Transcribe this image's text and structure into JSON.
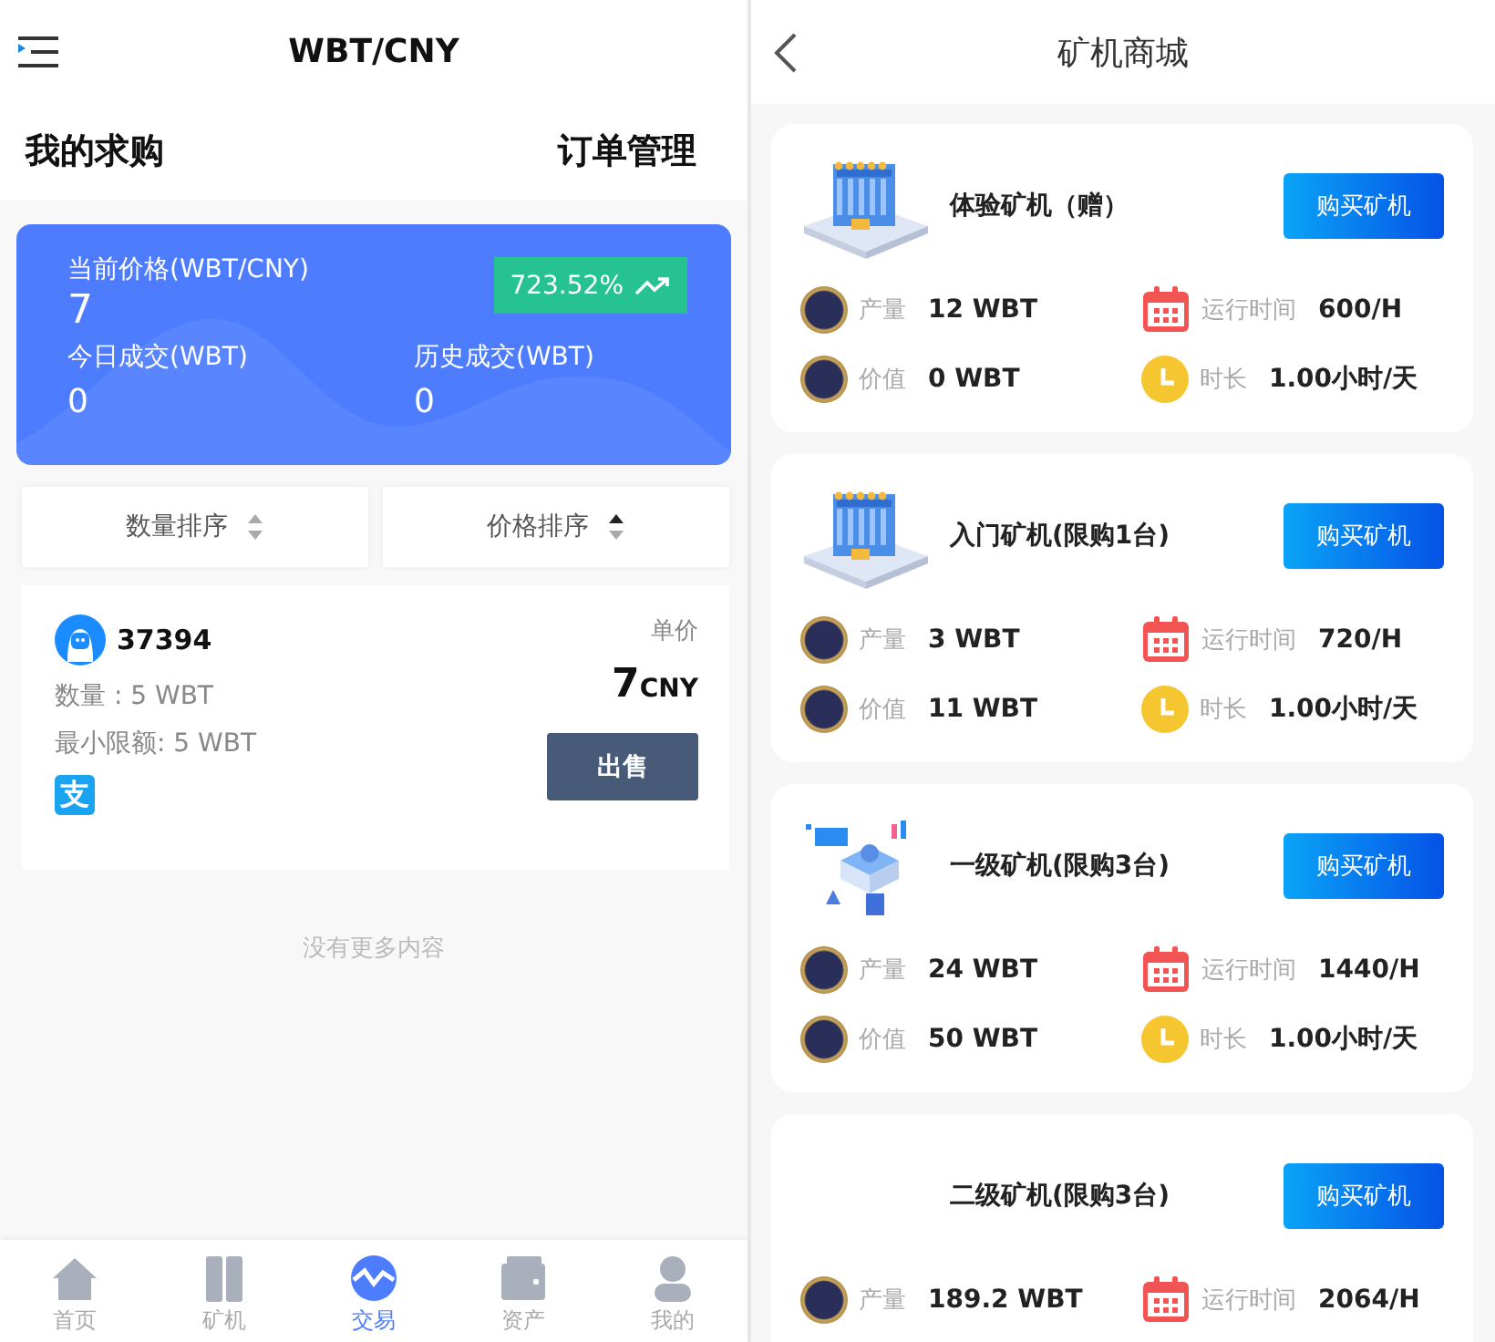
{
  "trade": {
    "title": "WBT/CNY",
    "left_link": "我的求购",
    "right_link": "订单管理",
    "summary": {
      "price_label": "当前价格(WBT/CNY)",
      "price": "7",
      "change": "723.52%",
      "today_label": "今日成交(WBT)",
      "today": "0",
      "history_label": "历史成交(WBT)",
      "history": "0"
    },
    "sorts": [
      {
        "label": "数量排序",
        "selected": false
      },
      {
        "label": "价格排序",
        "selected": true
      }
    ],
    "orders": [
      {
        "user": "37394",
        "price_label": "单价",
        "price": "7",
        "currency": "CNY",
        "quantity": "数量 : 5 WBT",
        "min_limit": "最小限额: 5 WBT",
        "payment_icon": "支",
        "action": "出售"
      }
    ],
    "end_note": "没有更多内容",
    "nav": [
      {
        "label": "首页",
        "selected": false
      },
      {
        "label": "矿机",
        "selected": false
      },
      {
        "label": "交易",
        "selected": true
      },
      {
        "label": "资产",
        "selected": false
      },
      {
        "label": "我的",
        "selected": false
      }
    ]
  },
  "shop": {
    "title": "矿机商城",
    "miners": [
      {
        "name": "体验矿机（赠）",
        "kind": "rack",
        "button": "购买矿机",
        "stats": [
          {
            "kind": "coin",
            "label": "产量",
            "value": "12 WBT"
          },
          {
            "kind": "calendar",
            "label": "运行时间",
            "value": "600/H"
          },
          {
            "kind": "coin",
            "label": "价值",
            "value": "0 WBT"
          },
          {
            "kind": "clock",
            "label": "时长",
            "value": "1.00小时/天"
          }
        ]
      },
      {
        "name": "入门矿机(限购1台)",
        "kind": "rack",
        "button": "购买矿机",
        "stats": [
          {
            "kind": "coin",
            "label": "产量",
            "value": "3 WBT"
          },
          {
            "kind": "calendar",
            "label": "运行时间",
            "value": "720/H"
          },
          {
            "kind": "coin",
            "label": "价值",
            "value": "11 WBT"
          },
          {
            "kind": "clock",
            "label": "时长",
            "value": "1.00小时/天"
          }
        ]
      },
      {
        "name": "一级矿机(限购3台)",
        "kind": "hologram",
        "button": "购买矿机",
        "stats": [
          {
            "kind": "coin",
            "label": "产量",
            "value": "24 WBT"
          },
          {
            "kind": "calendar",
            "label": "运行时间",
            "value": "1440/H"
          },
          {
            "kind": "coin",
            "label": "价值",
            "value": "50 WBT"
          },
          {
            "kind": "clock",
            "label": "时长",
            "value": "1.00小时/天"
          }
        ]
      },
      {
        "name": "二级矿机(限购3台)",
        "kind": "blank",
        "button": "购买矿机",
        "stats": [
          {
            "kind": "coin",
            "label": "产量",
            "value": "189.2 WBT"
          },
          {
            "kind": "calendar",
            "label": "运行时间",
            "value": "2064/H"
          }
        ]
      }
    ]
  }
}
